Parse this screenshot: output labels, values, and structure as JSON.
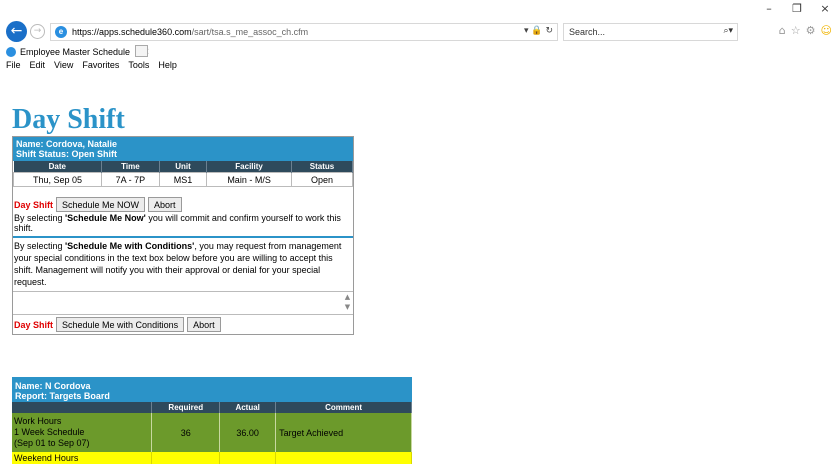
{
  "browser": {
    "url_host": "https://apps.schedule360.com",
    "url_path": "/sart/tsa.s_me_assoc_ch.cfm",
    "search_placeholder": "Search...",
    "tab_title": "Employee Master Schedule",
    "menu": [
      "File",
      "Edit",
      "View",
      "Favorites",
      "Tools",
      "Help"
    ],
    "window_controls": [
      "–",
      "❐",
      "×"
    ]
  },
  "page": {
    "title": "Day Shift"
  },
  "shift_panel": {
    "name_line": "Name: Cordova, Natalie",
    "status_line": "Shift Status: Open Shift",
    "columns": [
      "Date",
      "Time",
      "Unit",
      "Facility",
      "Status"
    ],
    "row": [
      "Thu, Sep 05",
      "7A - 7P",
      "MS1",
      "Main - M/S",
      "Open"
    ],
    "shift_label": "Day Shift",
    "schedule_now_label": "Schedule Me NOW",
    "abort_label": "Abort",
    "commit_prefix": "By selecting ",
    "commit_bold": "'Schedule Me Now'",
    "commit_suffix": " you will commit and confirm yourself to work this shift.",
    "conditions_prefix": "By selecting ",
    "conditions_bold": "'Schedule Me with Conditions'",
    "conditions_suffix": ", you may request from management your special conditions in the text box below before you are willing to accept this shift. Management will notify you with their approval or denial for your special request.",
    "conditions_value": "",
    "schedule_conditions_label": "Schedule Me with Conditions"
  },
  "targets_panel": {
    "name_line": "Name: N Cordova",
    "report_line": "Report: Targets Board",
    "columns": [
      "",
      "Required",
      "Actual",
      "Comment"
    ],
    "work_hours": {
      "label_lines": [
        "Work Hours",
        "1 Week Schedule",
        "(Sep 01 to Sep 07)"
      ],
      "required": "36",
      "actual": "36.00",
      "comment": "Target Achieved"
    },
    "weekend_label": "Weekend Hours"
  },
  "colors": {
    "accent": "#2b93c8",
    "header_dark": "#2e4a5c",
    "achieved_green": "#6c9a2b",
    "weekend_yellow": "#ffff00",
    "shift_red": "#e00000"
  }
}
